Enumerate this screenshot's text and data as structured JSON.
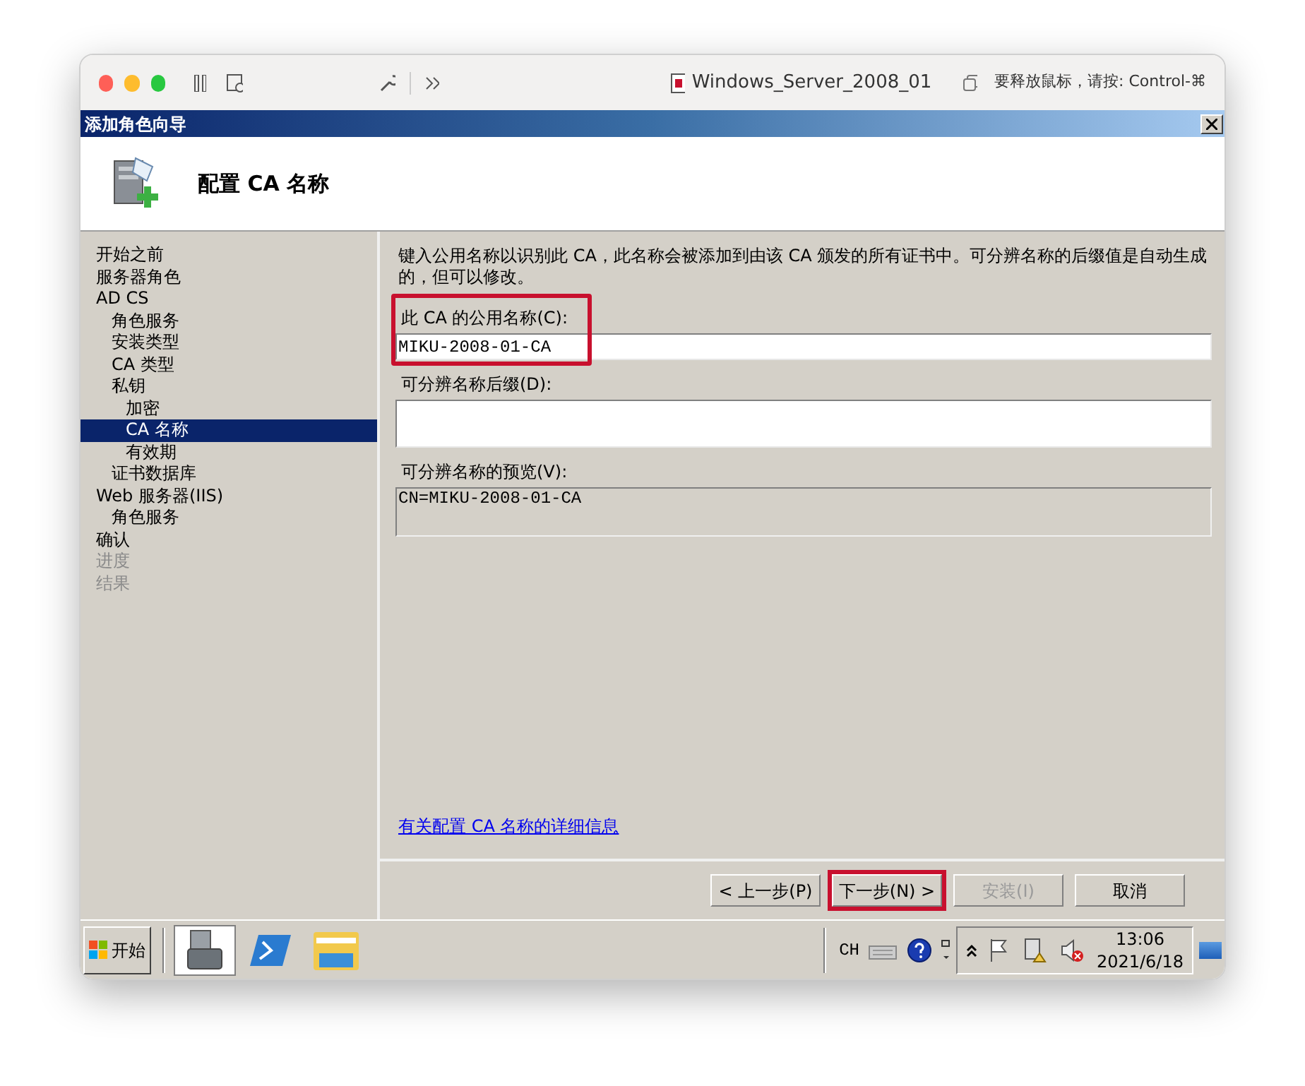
{
  "host_toolbar": {
    "vm_name": "Windows_Server_2008_01",
    "hint": "要释放鼠标，请按: Control-⌘"
  },
  "wizard": {
    "title": "添加角色向导",
    "heading": "配置 CA 名称"
  },
  "nav": [
    {
      "label": "开始之前",
      "selected": false,
      "disabled": false
    },
    {
      "label": "服务器角色",
      "selected": false,
      "disabled": false
    },
    {
      "label": "AD CS",
      "selected": false,
      "disabled": false,
      "children": [
        {
          "label": "角色服务",
          "selected": false,
          "disabled": false
        },
        {
          "label": "安装类型",
          "selected": false,
          "disabled": false
        },
        {
          "label": "CA 类型",
          "selected": false,
          "disabled": false
        },
        {
          "label": "私钥",
          "selected": false,
          "disabled": false,
          "children": [
            {
              "label": "加密",
              "selected": false,
              "disabled": false
            },
            {
              "label": "CA 名称",
              "selected": true,
              "disabled": false
            },
            {
              "label": "有效期",
              "selected": false,
              "disabled": false
            }
          ]
        },
        {
          "label": "证书数据库",
          "selected": false,
          "disabled": false
        }
      ]
    },
    {
      "label": "Web 服务器(IIS)",
      "selected": false,
      "disabled": false,
      "children": [
        {
          "label": "角色服务",
          "selected": false,
          "disabled": false
        }
      ]
    },
    {
      "label": "确认",
      "selected": false,
      "disabled": false
    },
    {
      "label": "进度",
      "selected": false,
      "disabled": true
    },
    {
      "label": "结果",
      "selected": false,
      "disabled": true
    }
  ],
  "content": {
    "description": "键入公用名称以识别此 CA，此名称会被添加到由该 CA 颁发的所有证书中。可分辨名称的后缀值是自动生成的，但可以修改。",
    "fields": [
      {
        "kind": "input",
        "label": "此 CA 的公用名称(C):",
        "value": "MIKU-2008-01-CA",
        "highlighted": true
      },
      {
        "kind": "textarea",
        "label": "可分辨名称后缀(D):",
        "highlighted": false
      },
      {
        "kind": "readonly",
        "label": "可分辨名称的预览(V):",
        "value": "CN=MIKU-2008-01-CA",
        "highlighted": false
      }
    ],
    "help_link": "有关配置 CA 名称的详细信息"
  },
  "buttons": [
    {
      "label": "< 上一步(P)",
      "disabled": false,
      "highlighted": false
    },
    {
      "label": "下一步(N) >",
      "disabled": false,
      "highlighted": true
    },
    {
      "label": "安装(I)",
      "disabled": true,
      "highlighted": false
    },
    {
      "label": "取消",
      "disabled": false,
      "highlighted": false
    }
  ],
  "taskbar": {
    "start": "开始",
    "language": "CH",
    "time": "13:06",
    "date": "2021/6/18"
  }
}
